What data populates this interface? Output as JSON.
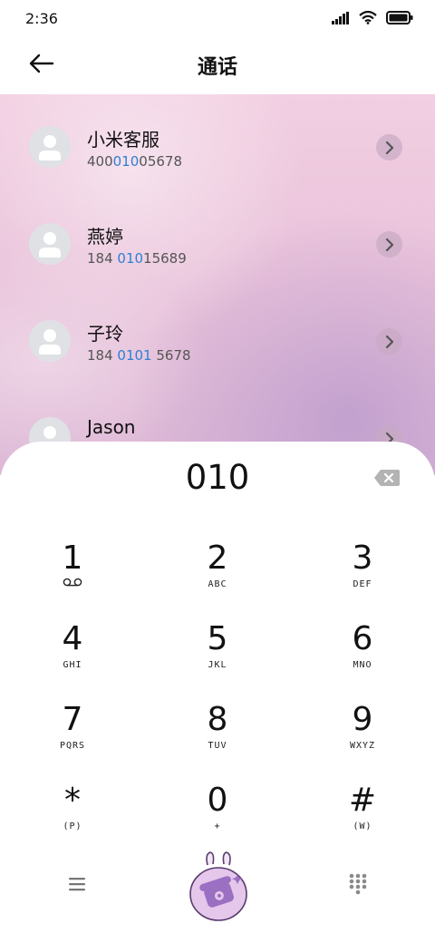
{
  "status_bar": {
    "time": "2:36"
  },
  "header": {
    "title": "通话"
  },
  "contacts": [
    {
      "name": "小米客服",
      "number_pre": "400",
      "number_match": "010",
      "number_post": "05678"
    },
    {
      "name": "燕婷",
      "number_pre": "184 ",
      "number_match": "010",
      "number_post": "15689"
    },
    {
      "name": "子玲",
      "number_pre": "184 ",
      "number_match": "0101",
      "number_post": " 5678"
    },
    {
      "name": "Jason",
      "number_pre": "",
      "number_match": "",
      "number_post": ""
    }
  ],
  "dialpad": {
    "input": "010",
    "keys": [
      {
        "digit": "1",
        "letters": "voicemail"
      },
      {
        "digit": "2",
        "letters": "ABC"
      },
      {
        "digit": "3",
        "letters": "DEF"
      },
      {
        "digit": "4",
        "letters": "GHI"
      },
      {
        "digit": "5",
        "letters": "JKL"
      },
      {
        "digit": "6",
        "letters": "MNO"
      },
      {
        "digit": "7",
        "letters": "PQRS"
      },
      {
        "digit": "8",
        "letters": "TUV"
      },
      {
        "digit": "9",
        "letters": "WXYZ"
      },
      {
        "digit": "*",
        "letters": "(P)"
      },
      {
        "digit": "0",
        "letters": "+"
      },
      {
        "digit": "#",
        "letters": "(W)"
      }
    ]
  },
  "colors": {
    "match_highlight": "#2d7fd3",
    "call_button": "#e4c7ea",
    "call_icon": "#9b6fc2"
  },
  "icons": {
    "back": "arrow-left-icon",
    "backspace": "backspace-icon",
    "menu": "menu-icon",
    "call": "phone-call-icon",
    "keypad": "dialpad-icon",
    "voicemail": "voicemail-icon"
  }
}
